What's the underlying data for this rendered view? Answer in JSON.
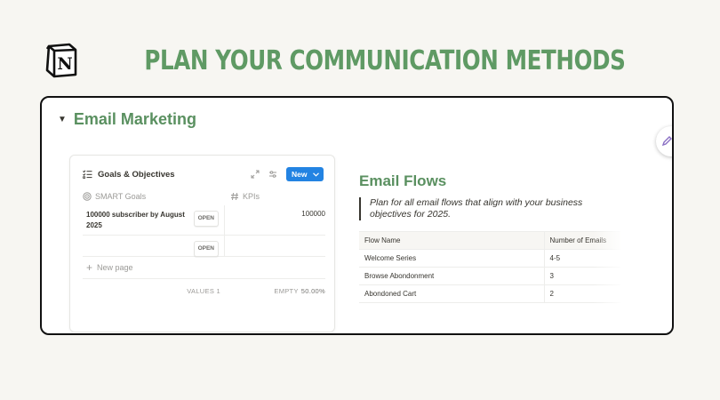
{
  "banner": {
    "logo_letter": "N",
    "title": "PLAN YOUR COMMUNICATION METHODS",
    "title_color": "#5f9a64"
  },
  "section": {
    "title": "Email Marketing",
    "toggle_icon": "triangle-down-icon",
    "edit_icon": "pencil-icon"
  },
  "database": {
    "title": "Goals & Objectives",
    "title_icon": "checklist-icon",
    "new_button": "New",
    "columns": {
      "goals": "SMART Goals",
      "kpis": "KPIs"
    },
    "rows": [
      {
        "goal": "100000 subscriber by August 2025",
        "kpi": "100000",
        "open": "OPEN"
      },
      {
        "goal": "",
        "kpi": "",
        "open": "OPEN"
      }
    ],
    "new_page": "New page",
    "footer": {
      "values_label": "VALUES",
      "values_count": "1",
      "empty_label": "EMPTY",
      "empty_value": "50.00%"
    },
    "accent": "#2383e2"
  },
  "flows": {
    "title": "Email Flows",
    "quote": "Plan for all email flows that align with your business objectives for 2025.",
    "headers": [
      "Flow Name",
      "Number of Emails"
    ],
    "rows": [
      [
        "Welcome Series",
        "4-5"
      ],
      [
        "Browse Abondonment",
        "3"
      ],
      [
        "Abondoned Cart",
        "2"
      ]
    ]
  }
}
